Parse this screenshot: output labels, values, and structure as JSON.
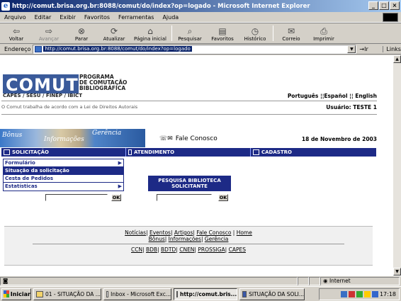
{
  "window": {
    "title": "http://comut.brisa.org.br:8088/comut/do/index?op=logado - Microsoft Internet Explorer"
  },
  "menubar": [
    "Arquivo",
    "Editar",
    "Exibir",
    "Favoritos",
    "Ferramentas",
    "Ajuda"
  ],
  "toolbar": [
    {
      "label": "Voltar",
      "icon": "back-arrow-icon",
      "enabled": true
    },
    {
      "label": "Avançar",
      "icon": "forward-arrow-icon",
      "enabled": false
    },
    {
      "label": "Parar",
      "icon": "stop-icon",
      "enabled": true
    },
    {
      "label": "Atualizar",
      "icon": "refresh-icon",
      "enabled": true
    },
    {
      "label": "Página inicial",
      "icon": "home-icon",
      "enabled": true
    },
    {
      "label": "Pesquisar",
      "icon": "search-icon",
      "enabled": true
    },
    {
      "label": "Favoritos",
      "icon": "favorites-icon",
      "enabled": true
    },
    {
      "label": "Histórico",
      "icon": "history-icon",
      "enabled": true
    },
    {
      "label": "Correio",
      "icon": "mail-icon",
      "enabled": true
    },
    {
      "label": "Imprimir",
      "icon": "print-icon",
      "enabled": true
    }
  ],
  "address": {
    "label": "Endereço",
    "url": "http://comut.brisa.org.br:8088/comut/do/index?op=logado",
    "go": "Ir",
    "links": "Links"
  },
  "page": {
    "logo": "COMUT",
    "program": [
      "PROGRAMA",
      "DE COMUTAÇÃO",
      "BIBLIOGRÁFICA"
    ],
    "partners": "CAPES / SESU / FINEP / IBICT",
    "languages": "Português ¦¦Español ¦¦ English",
    "law_notice": "O Comut trabalha de acordo com a Lei de Direitos Autorais",
    "user": "Usuário: TESTE 1",
    "banner": [
      "Bônus",
      "Informações",
      "Gerência"
    ],
    "contact": "Fale Conosco",
    "date": "18 de Novembro de 2003",
    "nav": [
      "SOLICITAÇÃO",
      "ATENDIMENTO",
      "CADASTRO"
    ],
    "submenu": [
      {
        "label": "Formulário",
        "has_arrow": true,
        "selected": false
      },
      {
        "label": "Situação da solicitação",
        "has_arrow": false,
        "selected": true
      },
      {
        "label": "Cesta de Pedidos",
        "has_arrow": false,
        "selected": false
      },
      {
        "label": "Estatísticas",
        "has_arrow": true,
        "selected": false
      }
    ],
    "pesquisa_title": "PESQUISA BIBLIOTECA SOLICITANTE",
    "ok_label": "OK",
    "footer_row1": [
      "Notícias",
      "Eventos",
      "Artigos",
      "Fale Conosco",
      "Home"
    ],
    "footer_row2": [
      "Bônus",
      "Informações",
      "Gerência"
    ],
    "footer_row3": [
      "CCN",
      "BDB",
      "BDTD",
      "CNEN",
      "PROSSIGA",
      "CAPES"
    ]
  },
  "statusbar": {
    "zone": "Internet"
  },
  "taskbar": {
    "start": "Iniciar",
    "tasks": [
      {
        "label": "01 - SITUAÇÃO DA ...",
        "active": false
      },
      {
        "label": "Inbox - Microsoft Exc...",
        "active": false
      },
      {
        "label": "http://comut.bris...",
        "active": true
      },
      {
        "label": "SITUAÇÃO DA SOLI...",
        "active": false
      }
    ],
    "clock": "17:18"
  }
}
